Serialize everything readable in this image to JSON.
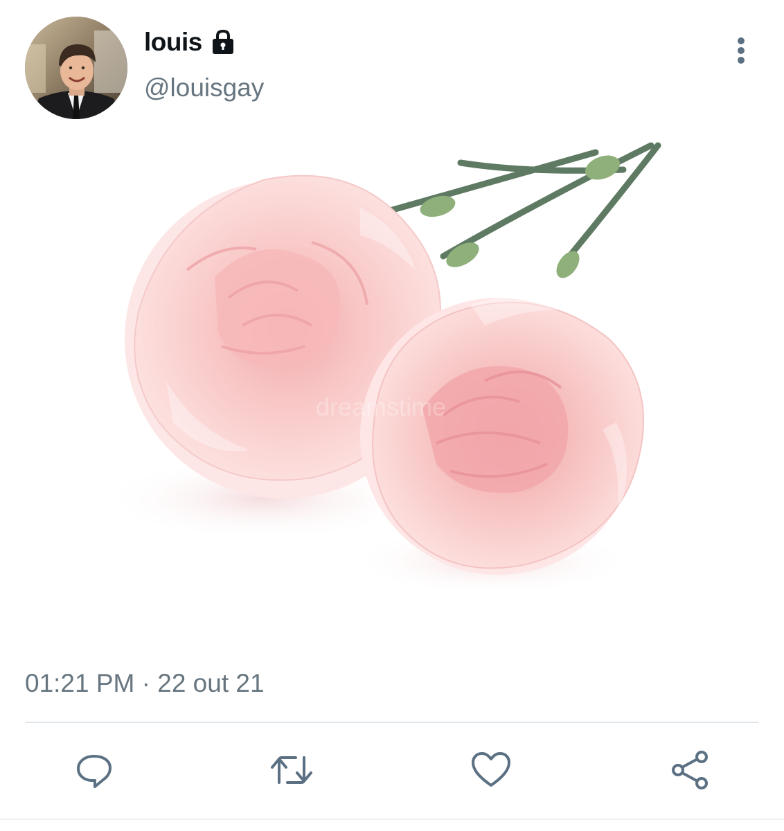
{
  "user": {
    "display_name": "louis",
    "handle": "@louisgay",
    "protected": true,
    "avatar_icon": "profile-photo"
  },
  "tweet": {
    "timestamp": "01:21 PM · 22 out 21",
    "media": {
      "description_icon": "carnation-photo",
      "watermark_text": "dreamstime"
    }
  },
  "actions": {
    "reply_icon": "reply-icon",
    "retweet_icon": "retweet-icon",
    "like_icon": "heart-icon",
    "share_icon": "share-icon"
  },
  "colors": {
    "secondary_text": "#66757f",
    "icon": "#5b7083",
    "divider": "#e1e8ed"
  }
}
